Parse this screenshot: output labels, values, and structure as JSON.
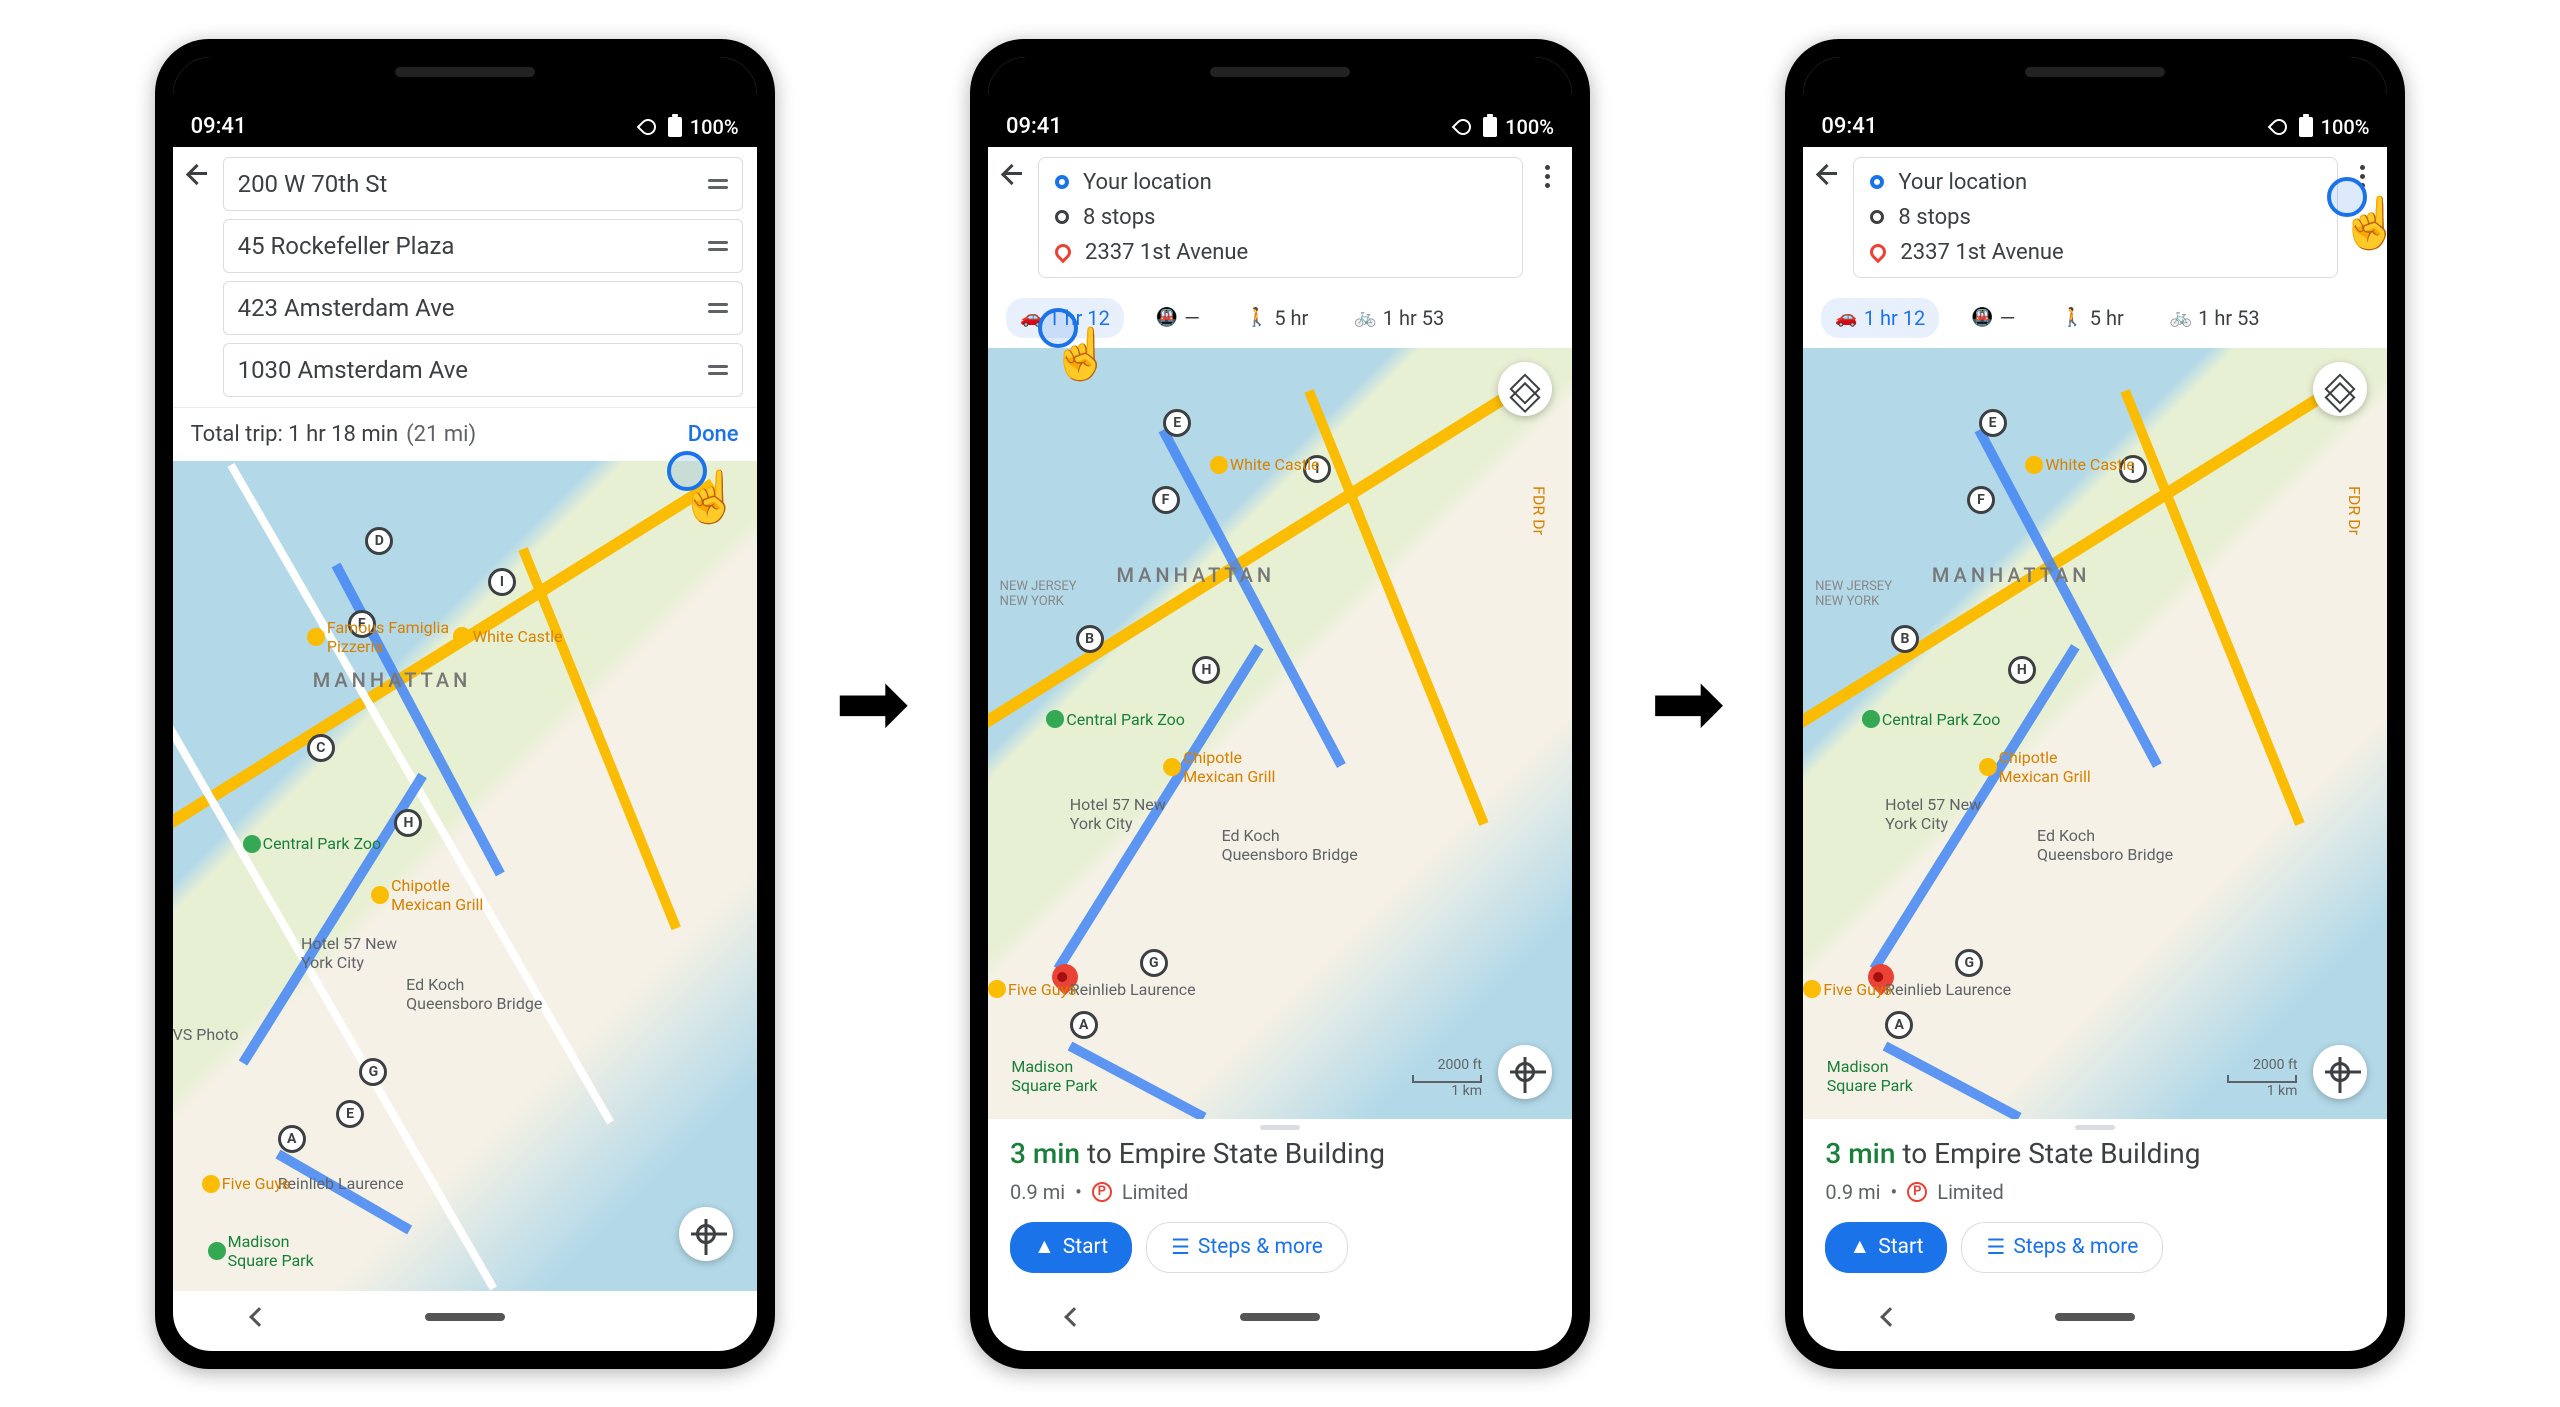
{
  "status": {
    "time": "09:41",
    "battery": "100%"
  },
  "screen1": {
    "stops": [
      "200 W 70th St",
      "45 Rockefeller Plaza",
      "423 Amsterdam Ave",
      "1030 Amsterdam Ave"
    ],
    "total_label": "Total trip: 1 hr 18 min",
    "distance": "(21 mi)",
    "done": "Done"
  },
  "dir_header": {
    "origin": "Your location",
    "stops": "8 stops",
    "dest": "2337 1st Avenue"
  },
  "modes": {
    "car": "1 hr 12",
    "transit": "—",
    "walk": "5 hr",
    "bike": "1 hr 53"
  },
  "map": {
    "manhattan": "MANHATTAN",
    "nj": "NEW JERSEY\nNEW YORK",
    "waypoints": [
      "A",
      "B",
      "C",
      "D",
      "E",
      "F",
      "G",
      "H",
      "I"
    ],
    "pois": {
      "pizzeria": "Famous Famiglia\nPizzeria",
      "white_castle": "White Castle",
      "zoo": "Central Park Zoo",
      "chipotle": "Chipotle\nMexican Grill",
      "hotel57": "Hotel 57 New\nYork City",
      "bridge": "Ed Koch\nQueensboro Bridge",
      "reinlieb": "Reinlieb Laurence",
      "five_guys": "Five Guys",
      "madison": "Madison\nSquare Park",
      "photo": "VS Photo",
      "fdr": "FDR Dr"
    },
    "scale": {
      "ft": "2000 ft",
      "km": "1 km"
    }
  },
  "bottom": {
    "eta_time": "3 min",
    "eta_rest": " to Empire State Building",
    "dist": "0.9 mi",
    "dot": "•",
    "p": "P",
    "limited": "Limited",
    "start": "Start",
    "steps": "Steps & more"
  }
}
